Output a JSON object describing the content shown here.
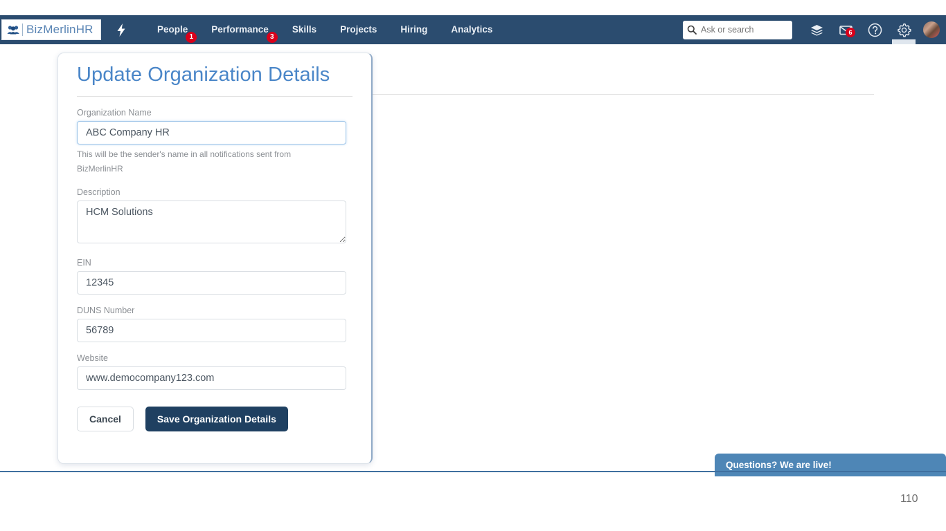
{
  "app": {
    "logo_text": "BizMerlinHR",
    "logo_icon": "people-group-icon",
    "bolt_icon": "lightning-bolt-icon"
  },
  "navbar": {
    "background": "#2b4c6f",
    "links": [
      {
        "label": "People",
        "badge": "1"
      },
      {
        "label": "Performance",
        "badge": "3"
      },
      {
        "label": "Skills",
        "badge": ""
      },
      {
        "label": "Projects",
        "badge": ""
      },
      {
        "label": "Hiring",
        "badge": ""
      },
      {
        "label": "Analytics",
        "badge": ""
      }
    ],
    "search": {
      "placeholder": "Ask or search",
      "value": "",
      "icon": "search-icon"
    },
    "icons": [
      {
        "name": "layers-icon",
        "badge": ""
      },
      {
        "name": "envelope-icon",
        "badge": "6"
      },
      {
        "name": "help-circle-icon",
        "badge": ""
      },
      {
        "name": "gear-icon",
        "badge": ""
      }
    ],
    "avatar": "user-avatar",
    "badge_color": "#d9001b"
  },
  "card": {
    "title": "Update Organization Details",
    "title_color": "#4a86c8",
    "fields": {
      "organization_name": {
        "label": "Organization Name",
        "value": "ABC Company HR",
        "help": "This will be the sender's name in all notifications sent from BizMerlinHR"
      },
      "description": {
        "label": "Description",
        "value": "HCM Solutions"
      },
      "ein": {
        "label": "EIN",
        "value": "12345"
      },
      "duns_number": {
        "label": "DUNS Number",
        "value": "56789"
      },
      "website": {
        "label": "Website",
        "value": "www.democompany123.com"
      }
    },
    "actions": {
      "cancel_label": "Cancel",
      "save_label": "Save Organization Details",
      "save_color": "#1f4061"
    }
  },
  "chat_widget": {
    "label": "Questions? We are live!",
    "color": "#4e86b6"
  },
  "footer": {
    "page_number": "110"
  }
}
